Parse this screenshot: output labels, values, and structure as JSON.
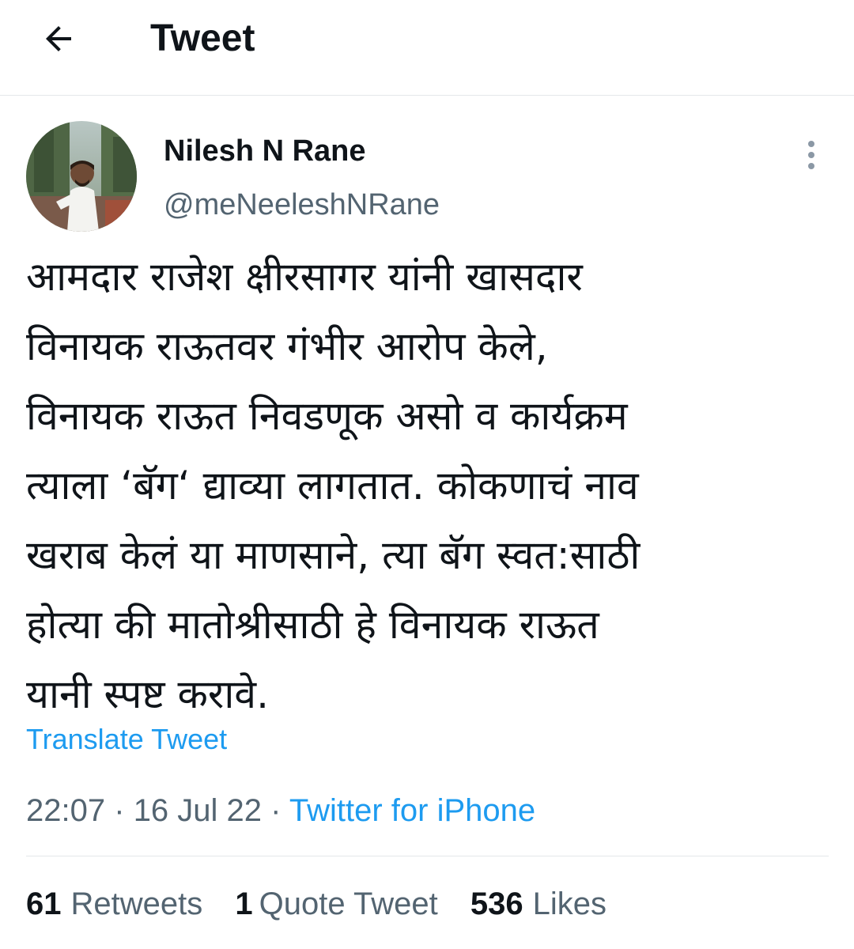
{
  "header": {
    "title": "Tweet",
    "back_icon": "arrow-left-icon"
  },
  "author": {
    "name": "Nilesh N Rane",
    "handle": "@meNeeleshNRane",
    "more_icon": "more-vertical-icon"
  },
  "tweet": {
    "text": "आमदार राजेश क्षीरसागर यांनी खासदार\nविनायक राऊतवर गंभीर आरोप केले,\nविनायक राऊत निवडणूक असो व कार्यक्रम\nत्याला ‘बॅग‘ द्याव्या लागतात. कोकणाचं नाव\nखराब केलं या माणसाने, त्या बॅग स्वत:साठी\nहोत्या की मातोश्रीसाठी हे विनायक राऊत\nयानी स्पष्ट करावे.",
    "translate_label": "Translate Tweet"
  },
  "meta": {
    "time": "22:07",
    "separator": "·",
    "date": "16 Jul 22",
    "source": "Twitter for iPhone"
  },
  "stats": {
    "retweets_count": "61",
    "retweets_label": "Retweets",
    "quotes_count": "1",
    "quotes_label": "Quote Tweet",
    "likes_count": "536",
    "likes_label": "Likes"
  },
  "colors": {
    "link": "#1d9bf0",
    "secondary_text": "#536471",
    "primary_text": "#0f1419",
    "divider": "#e4e7ea"
  }
}
